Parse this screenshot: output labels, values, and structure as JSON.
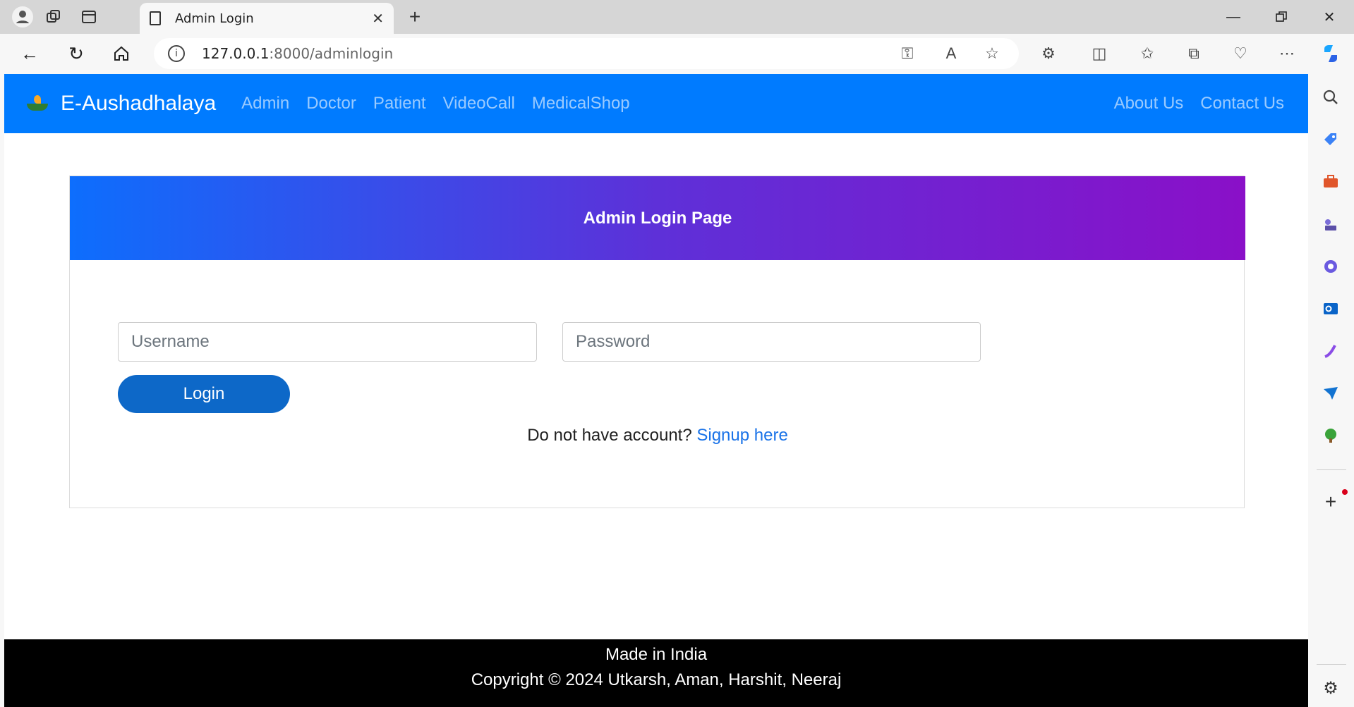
{
  "browser": {
    "tab_title": "Admin Login",
    "url_host": "127.0.0.1",
    "url_path": ":8000/adminlogin"
  },
  "site": {
    "brand": "E-Aushadhalaya",
    "nav_links": [
      "Admin",
      "Doctor",
      "Patient",
      "VideoCall",
      "MedicalShop"
    ],
    "nav_right": [
      "About Us",
      "Contact Us"
    ],
    "brand_color": "#007bff"
  },
  "login": {
    "title": "Admin Login Page",
    "username_placeholder": "Username",
    "password_placeholder": "Password",
    "login_label": "Login",
    "signup_prompt": "Do not have account?",
    "signup_link": "Signup here"
  },
  "footer": {
    "line1": "Made in India",
    "line2": "Copyright © 2024 Utkarsh, Aman, Harshit, Neeraj"
  },
  "icons": {
    "sidebar": [
      "search-icon",
      "tag-icon",
      "briefcase-icon",
      "chess-icon",
      "copilot-icon",
      "outlook-icon",
      "designer-icon",
      "send-icon",
      "tree-icon",
      "add-icon",
      "settings-icon"
    ]
  }
}
